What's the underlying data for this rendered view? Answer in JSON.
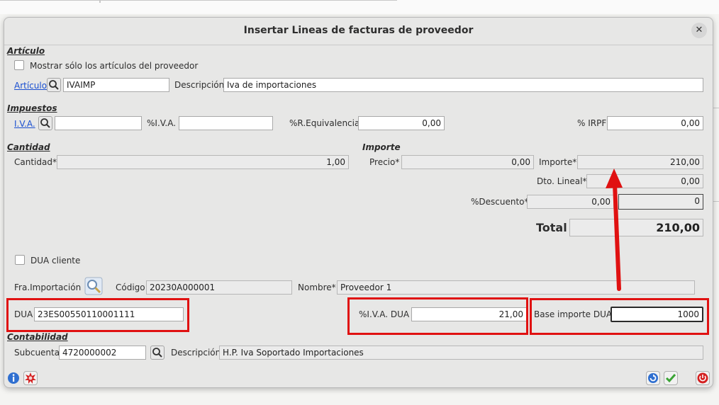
{
  "dialog": {
    "title": "Insertar Lineas de facturas de proveedor",
    "close_glyph": "✕"
  },
  "articulo": {
    "section": "Artículo",
    "checkbox_label": "Mostrar sólo los artículos del proveedor",
    "link": "Artículo",
    "code_value": "IVAIMP",
    "descripcion_label": "Descripción",
    "descripcion_value": "Iva de importaciones"
  },
  "impuestos": {
    "section": "Impuestos",
    "iva_link": "I.V.A.",
    "iva_value": "",
    "piva_label": "%I.V.A.",
    "piva_value": "",
    "req_label": "%R.Equivalencia",
    "req_value": "0,00",
    "irpf_label": "% IRPF",
    "irpf_value": "0,00"
  },
  "cantidad": {
    "section": "Cantidad",
    "label": "Cantidad*",
    "value": "1,00"
  },
  "importe": {
    "section": "Importe",
    "precio_label": "Precio*",
    "precio_value": "0,00",
    "importe_label": "Importe*",
    "importe_value": "210,00",
    "dto_label": "Dto. Lineal*",
    "dto_value": "0,00",
    "pdesc_label": "%Descuento*",
    "pdesc_value": "0,00",
    "pdesc_amount": "0",
    "total_label": "Total",
    "total_value": "210,00"
  },
  "dua": {
    "cliente_label": "DUA cliente",
    "fra_label": "Fra.Importación",
    "codigo_label": "Código",
    "codigo_value": "20230A000001",
    "nombre_label": "Nombre*",
    "nombre_value": "Proveedor 1",
    "dua_label": "DUA",
    "dua_value": "23ES00550110001111",
    "piva_dua_label": "%I.V.A. DUA",
    "piva_dua_value": "21,00",
    "base_label": "Base importe DUA",
    "base_value": "1000"
  },
  "contabilidad": {
    "section": "Contabilidad",
    "subcuenta_label": "Subcuenta",
    "subcuenta_value": "4720000002",
    "descripcion_label": "Descripción",
    "descripcion_value": "H.P. Iva Soportado Importaciones"
  },
  "toolbar": {
    "info_icon": "info-icon",
    "bug_icon": "bug-icon",
    "refresh_icon": "refresh-icon",
    "accept_icon": "check-icon",
    "cancel_icon": "power-icon"
  },
  "colors": {
    "highlight": "#e01111",
    "link": "#1a4fd0"
  }
}
